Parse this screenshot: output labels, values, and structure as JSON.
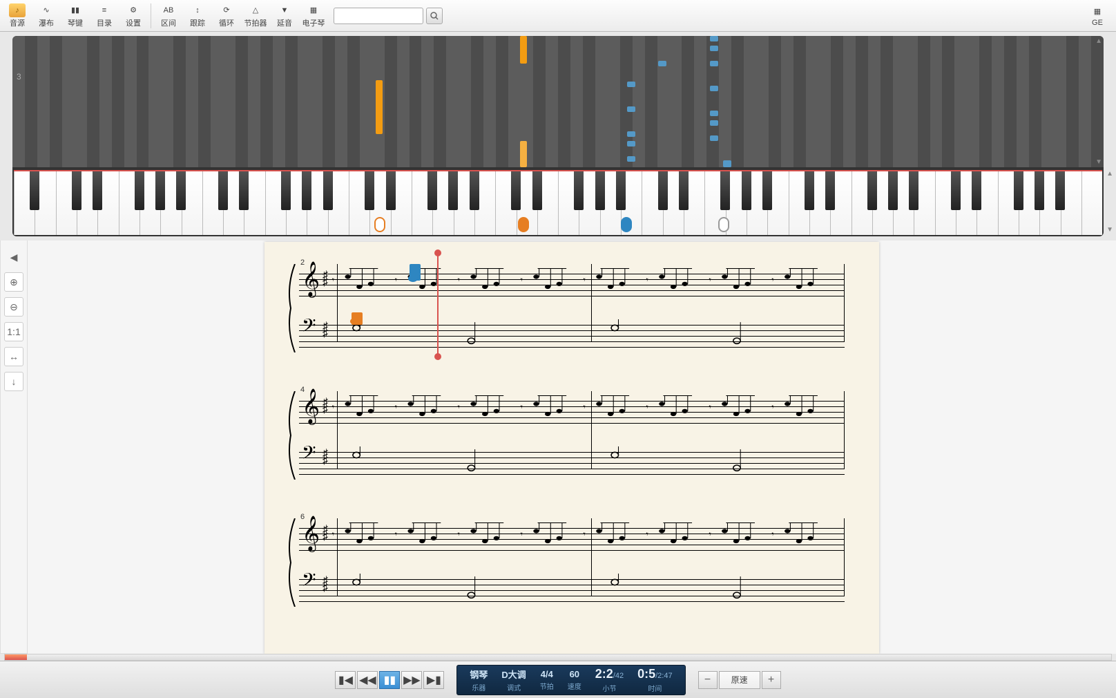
{
  "toolbar": {
    "buttons": [
      {
        "label": "音源",
        "icon": "♪",
        "vip": true
      },
      {
        "label": "瀑布",
        "icon": "∿"
      },
      {
        "label": "琴键",
        "icon": "▮▮"
      },
      {
        "label": "目录",
        "icon": "≡"
      },
      {
        "label": "设置",
        "icon": "⚙"
      }
    ],
    "buttons2": [
      {
        "label": "区间",
        "icon": "AB"
      },
      {
        "label": "跟踪",
        "icon": "↕"
      },
      {
        "label": "循环",
        "icon": "⟳"
      },
      {
        "label": "节拍器",
        "icon": "△"
      },
      {
        "label": "延音",
        "icon": "▼"
      },
      {
        "label": "电子琴",
        "icon": "▦"
      }
    ],
    "right_label": "GE"
  },
  "roll": {
    "bar_label": "3"
  },
  "side_tools": [
    "◀",
    "⊕",
    "⊖",
    "1:1",
    "↔",
    "↓"
  ],
  "score": {
    "measure_nums": [
      "2",
      "4",
      "6"
    ]
  },
  "transport": {
    "instrument": "钢琴",
    "instrument_lbl": "乐器",
    "key": "D大调",
    "key_lbl": "调式",
    "time_sig_top": "4",
    "time_sig_bot": "4",
    "time_sig_lbl": "节拍",
    "tempo": "60",
    "tempo_lbl": "速度",
    "measure": "2:2",
    "measure_total": "/42",
    "measure_lbl": "小节",
    "time": "0:5",
    "time_total": "/2:47",
    "time_lbl": "时间",
    "speed_label": "原速"
  }
}
